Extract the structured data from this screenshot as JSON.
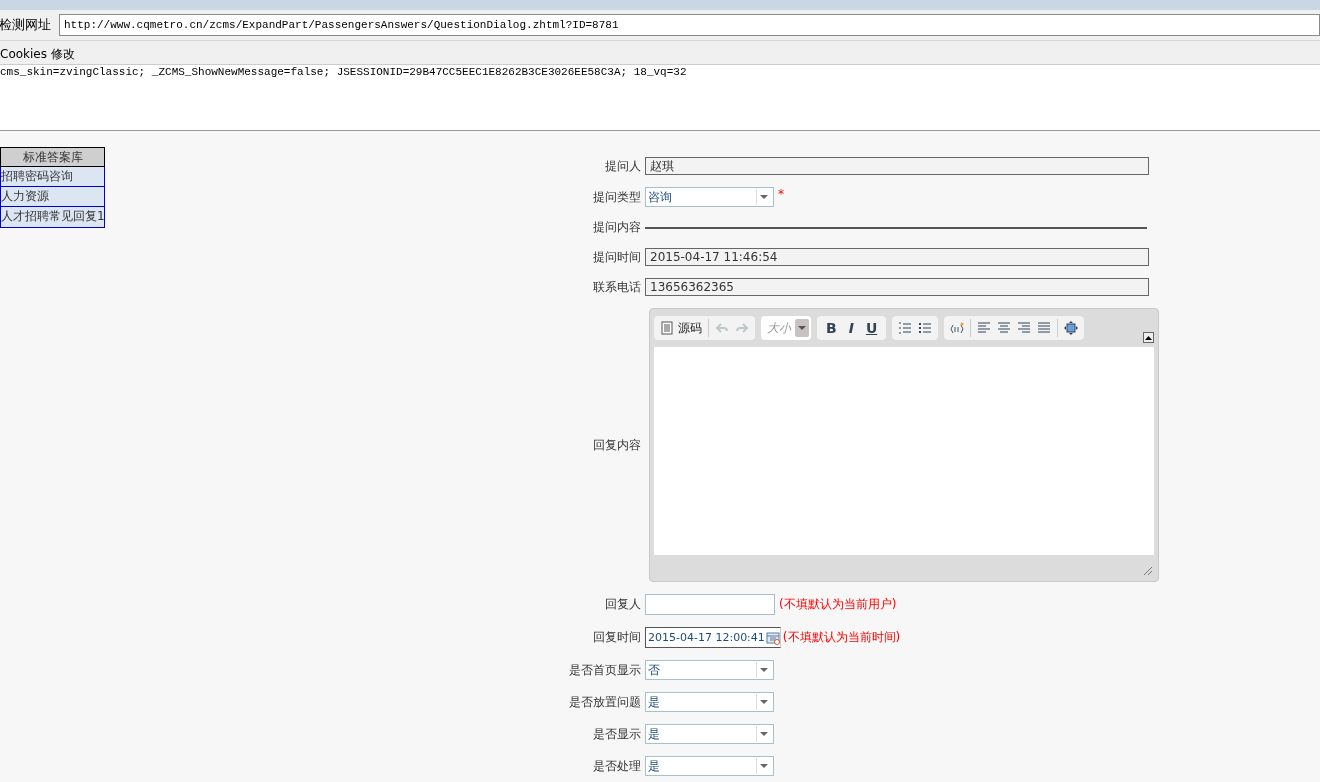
{
  "url_bar": {
    "label": "检测网址",
    "value": "http://www.cqmetro.cn/zcms/ExpandPart/PassengersAnswers/QuestionDialog.zhtml?ID=8781"
  },
  "cookies": {
    "label": "Cookies 修改",
    "value": "cms_skin=zvingClassic; _ZCMS_ShowNewMessage=false; JSESSIONID=29B47CC5EEC1E8262B3CE3026EE58C3A; 18_vq=32"
  },
  "sidebar": {
    "header": "标准答案库",
    "items": [
      {
        "label": "招聘密码咨询"
      },
      {
        "label": "人力资源"
      },
      {
        "label": "人才招聘常见回复1"
      }
    ]
  },
  "form": [
    {
      "kind": "text",
      "label": "提问人",
      "value": "赵琪"
    },
    {
      "kind": "select",
      "label": "提问类型",
      "value": "咨询",
      "required": true,
      "required_mark": "*"
    },
    {
      "kind": "rule",
      "label": "提问内容"
    },
    {
      "kind": "text",
      "label": "提问时间",
      "value": "2015-04-17 11:46:54"
    },
    {
      "kind": "text",
      "label": "联系电话",
      "value": "13656362365"
    },
    {
      "kind": "editor",
      "label": "回复内容",
      "source_label": "源码",
      "font_size_label": "大小",
      "bold_label": "B",
      "italic_label": "I",
      "underline_label": "U",
      "undo_disabled": true,
      "redo_disabled": true
    },
    {
      "kind": "input",
      "label": "回复人",
      "hint": "(不填默认为当前用户)"
    },
    {
      "kind": "datetime",
      "label": "回复时间",
      "value": "2015-04-17 12:00:41",
      "hint": "(不填默认为当前时间)"
    },
    {
      "kind": "select",
      "label": "是否首页显示",
      "value": "否"
    },
    {
      "kind": "select",
      "label": "是否放置问题",
      "value": "是"
    },
    {
      "kind": "select",
      "label": "是否显示",
      "value": "是"
    },
    {
      "kind": "select",
      "label": "是否处理",
      "value": "是"
    }
  ]
}
